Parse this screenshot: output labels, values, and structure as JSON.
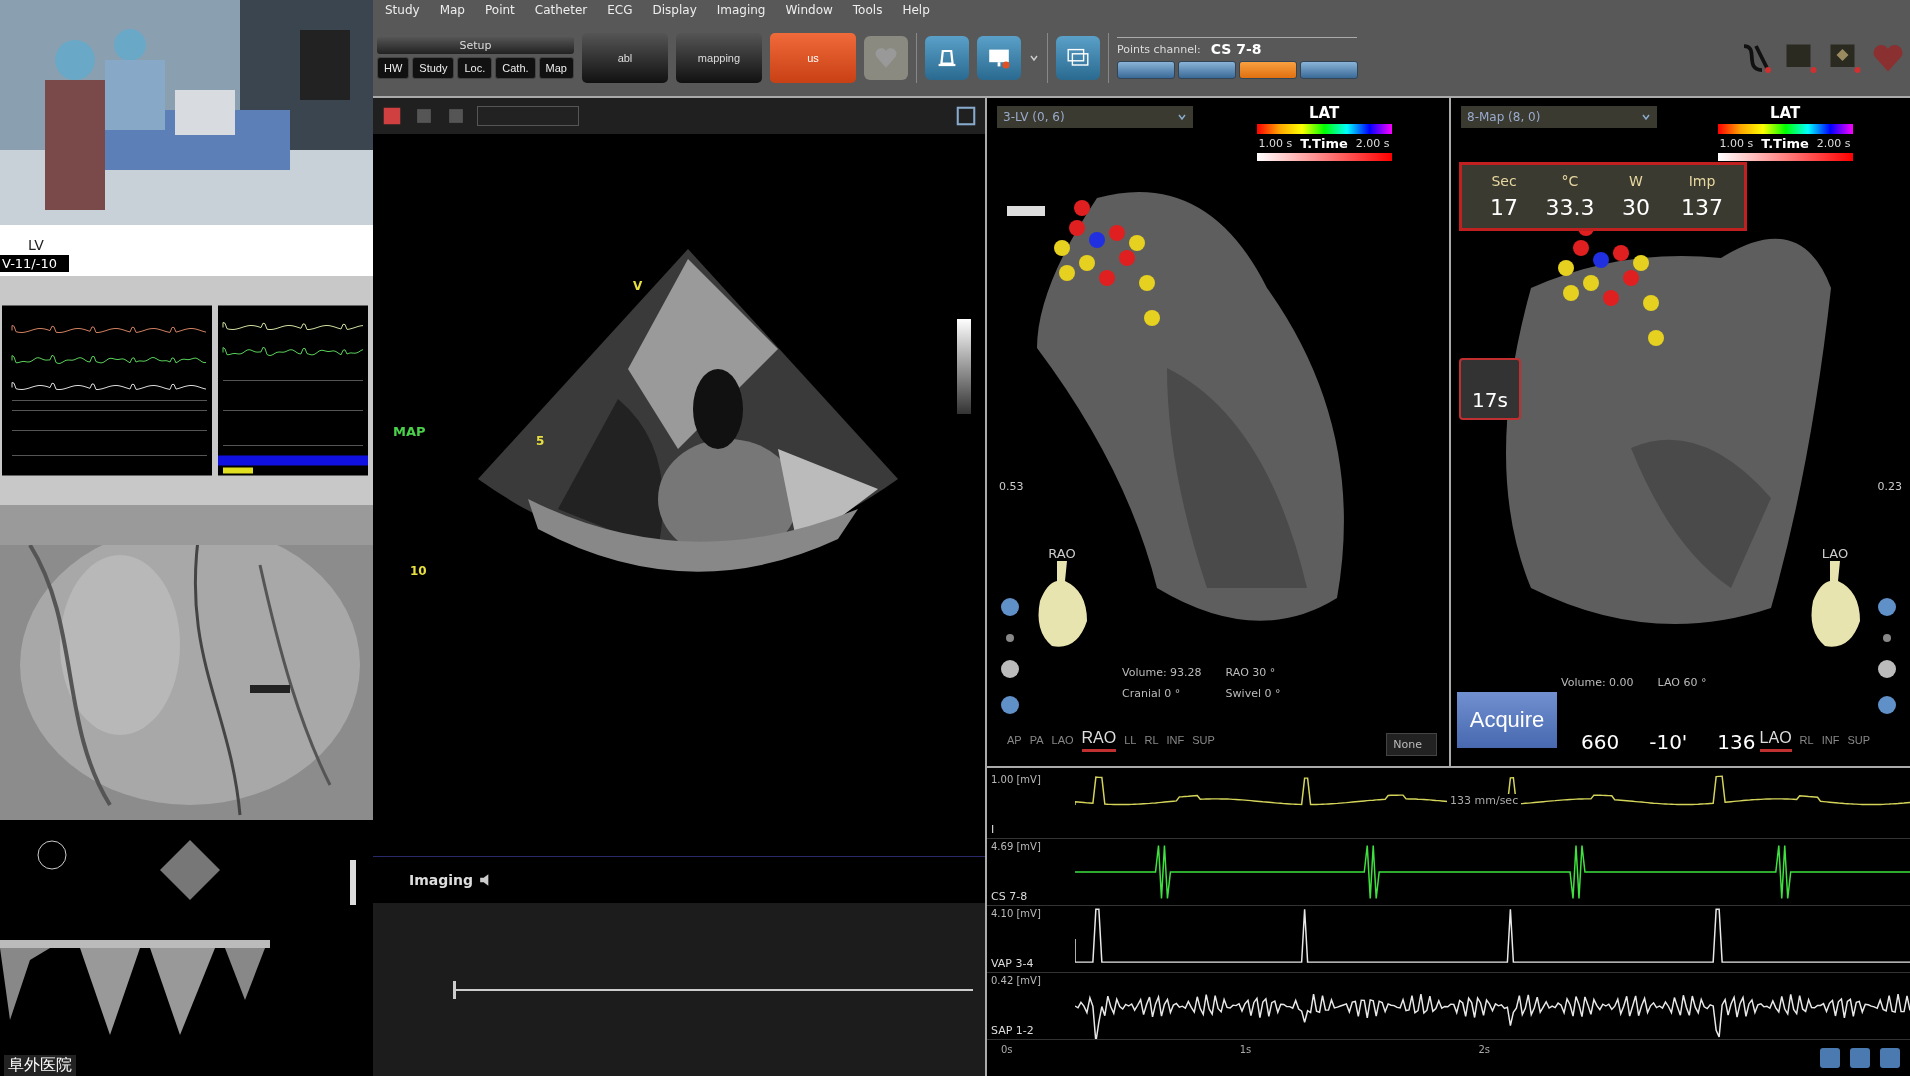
{
  "menu": [
    "Study",
    "Map",
    "Point",
    "Catheter",
    "ECG",
    "Display",
    "Imaging",
    "Window",
    "Tools",
    "Help"
  ],
  "setup": {
    "title": "Setup",
    "tabs": [
      "HW",
      "Study",
      "Loc.",
      "Cath.",
      "Map"
    ]
  },
  "modes": [
    {
      "label": "abl",
      "selected": false
    },
    {
      "label": "mapping",
      "selected": false
    },
    {
      "label": "us",
      "selected": true
    }
  ],
  "points_channel": {
    "label": "Points channel:",
    "value": "CS 7-8"
  },
  "channel_buttons": [
    {
      "selected": false
    },
    {
      "selected": false
    },
    {
      "selected": true
    },
    {
      "selected": false
    }
  ],
  "recording": {
    "site": "LV",
    "channel": "V-11/-10"
  },
  "echo": {
    "mode": "MAP",
    "markers": [
      "V",
      "5",
      "10"
    ],
    "footer": "Imaging",
    "timeline": {
      "level": 0
    }
  },
  "maps": [
    {
      "dropdown": "3-LV (0, 6)",
      "legend_title": "LAT",
      "min": "1.00 s",
      "legend_label": "T.Time",
      "max": "2.00 s",
      "scale": "0.53",
      "orientation": "RAO",
      "stats": [
        "Volume: 93.28",
        "RAO  30 °",
        "Cranial  0 °",
        "Swivel  0 °"
      ],
      "views": [
        {
          "label": "AP",
          "selected": false
        },
        {
          "label": "PA",
          "selected": false
        },
        {
          "label": "LAO",
          "selected": false
        },
        {
          "label": "RAO",
          "selected": true
        },
        {
          "label": "LL",
          "selected": false
        },
        {
          "label": "RL",
          "selected": false
        },
        {
          "label": "INF",
          "selected": false
        },
        {
          "label": "SUP",
          "selected": false
        }
      ],
      "filter": "None"
    },
    {
      "dropdown": "8-Map (8, 0)",
      "legend_title": "LAT",
      "min": "1.00 s",
      "legend_label": "T.Time",
      "max": "2.00 s",
      "scale": "0.23",
      "orientation": "LAO",
      "stats": [
        "Volume: 0.00",
        "LAO  60 °"
      ],
      "views": [
        {
          "label": "LAO",
          "selected": true
        },
        {
          "label": "RL",
          "selected": false
        },
        {
          "label": "INF",
          "selected": false
        },
        {
          "label": "SUP",
          "selected": false
        }
      ],
      "timer": "17s",
      "acquire": "Acquire",
      "readouts": [
        "660",
        "-10'",
        "136"
      ]
    }
  ],
  "ablation": {
    "columns": [
      "Sec",
      "°C",
      "W",
      "Imp"
    ],
    "values": [
      "17",
      "33.3",
      "30",
      "137"
    ]
  },
  "ecg": {
    "speed": "133 mm/sec",
    "channels": [
      {
        "scale": "1.00 [mV]",
        "name": "I",
        "color": "#d4d45a"
      },
      {
        "scale": "4.69 [mV]",
        "name": "CS 7-8",
        "color": "#3fe03f"
      },
      {
        "scale": "4.10 [mV]",
        "name": "VAP 3-4",
        "color": "#e8e8e8"
      },
      {
        "scale": "0.42 [mV]",
        "name": "SAP 1-2",
        "color": "#e8e8e8"
      }
    ],
    "time_labels": [
      "0s",
      "1s",
      "2s"
    ]
  },
  "hospital": "阜外医院"
}
